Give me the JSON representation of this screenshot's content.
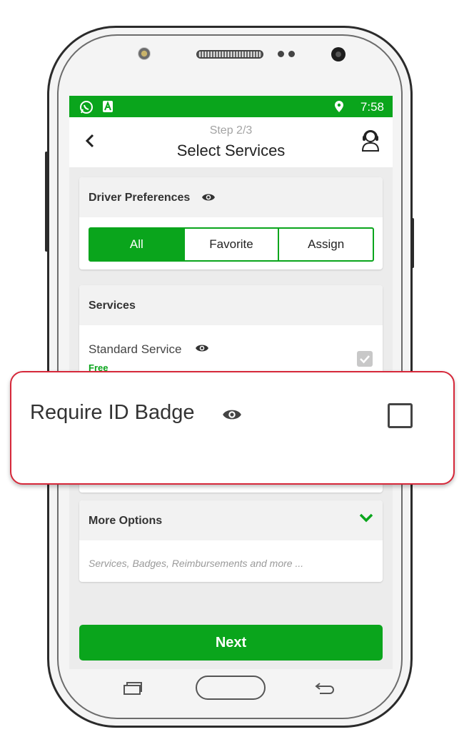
{
  "status_bar": {
    "time": "7:58"
  },
  "header": {
    "step": "Step 2/3",
    "title": "Select Services"
  },
  "driver_preferences": {
    "title": "Driver Preferences",
    "options": [
      "All",
      "Favorite",
      "Assign"
    ],
    "selected": "All"
  },
  "services": {
    "title": "Services",
    "items": [
      {
        "name": "Standard Service",
        "price": "Free",
        "checked": true
      }
    ]
  },
  "callout": {
    "label": "Require ID Badge",
    "checked": false
  },
  "more_options": {
    "title": "More Options",
    "subtitle": "Services, Badges, Reimbursements and more ..."
  },
  "next_button": "Next",
  "colors": {
    "accent": "#0aa51c",
    "callout_border": "#d6283a"
  }
}
